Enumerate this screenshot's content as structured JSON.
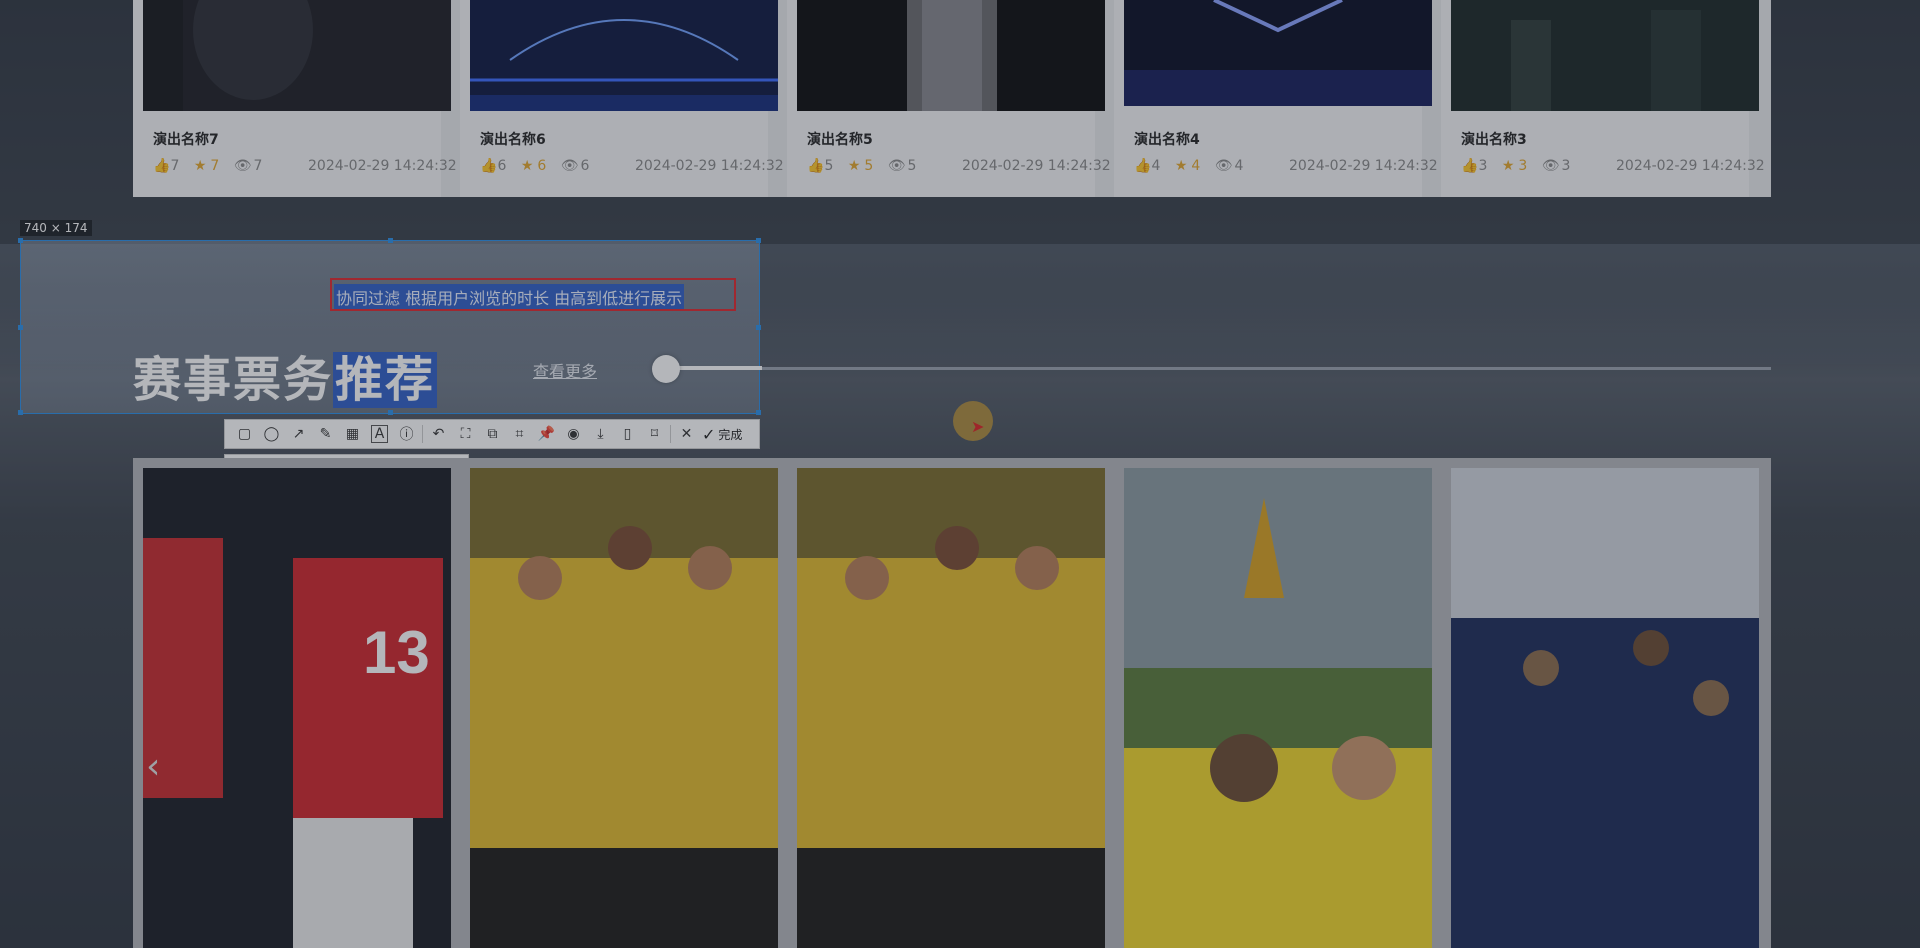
{
  "performances": [
    {
      "title": "演出名称7",
      "likes": "7",
      "stars": "7",
      "views": "7",
      "date": "2024-02-29 14:24:32"
    },
    {
      "title": "演出名称6",
      "likes": "6",
      "stars": "6",
      "views": "6",
      "date": "2024-02-29 14:24:32"
    },
    {
      "title": "演出名称5",
      "likes": "5",
      "stars": "5",
      "views": "5",
      "date": "2024-02-29 14:24:32"
    },
    {
      "title": "演出名称4",
      "likes": "4",
      "stars": "4",
      "views": "4",
      "date": "2024-02-29 14:24:32"
    },
    {
      "title": "演出名称3",
      "likes": "3",
      "stars": "3",
      "views": "3",
      "date": "2024-02-29 14:24:32"
    }
  ],
  "section": {
    "title_plain": "赛事票务",
    "title_highlight": "推荐",
    "subtitle": "协同过滤 根据用户浏览的时长 由高到低进行展示",
    "more_link": "查看更多",
    "slider_progress": 0.086
  },
  "capture": {
    "size_label": "740 × 174",
    "done_label": "完成",
    "font_size": "12"
  },
  "toolbar_icons": [
    "rectangle-icon",
    "ellipse-icon",
    "arrow-icon",
    "pencil-icon",
    "mosaic-icon",
    "text-icon",
    "serial-number-icon",
    "undo-icon",
    "crop-icon",
    "copy-icon",
    "ocr-icon",
    "pin-icon",
    "record-icon",
    "download-icon",
    "save-icon",
    "bookmark-icon",
    "close-icon",
    "check-icon"
  ],
  "palette_colors": [
    "#000000",
    "#808080",
    "#800000",
    "#ff8000",
    "#008000",
    "#000080",
    "#800080",
    "#008080",
    "#ffffff",
    "#c0c0c0",
    "#ff0000",
    "#ffff00",
    "#80ff00",
    "#0080ff",
    "#ff00ff",
    "#00ffff"
  ],
  "current_color": "#f43b3b"
}
